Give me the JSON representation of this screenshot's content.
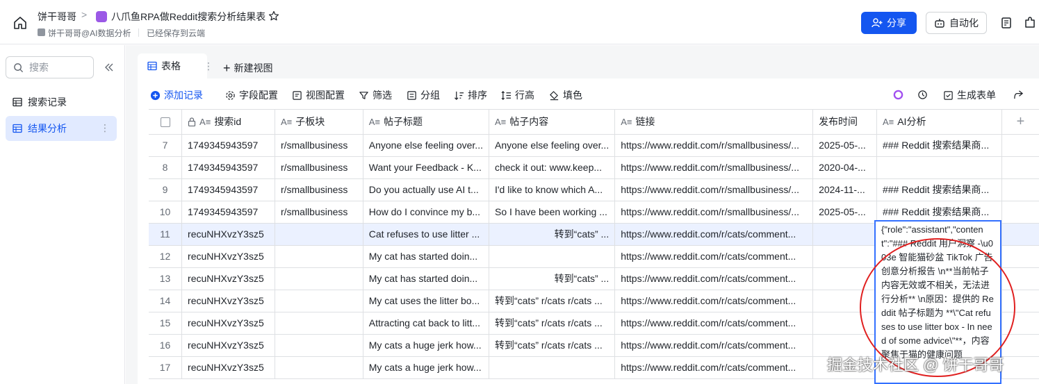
{
  "header": {
    "breadcrumb_root": "饼干哥哥",
    "breadcrumb_sep": ">",
    "doc_title": "八爪鱼RPA做Reddit搜索分析结果表",
    "owner": "饼干哥哥@AI数据分析",
    "save_status": "已经保存到云端",
    "share_label": "分享",
    "automation_label": "自动化",
    "accent_color": "#1456f0"
  },
  "sidebar": {
    "search_placeholder": "搜索",
    "items": [
      {
        "label": "搜索记录",
        "active": false
      },
      {
        "label": "结果分析",
        "active": true
      }
    ],
    "more_glyph": "⋮"
  },
  "tabs": {
    "active_label": "表格",
    "more_glyph": "⋮",
    "new_view_label": "新建视图"
  },
  "toolbar": {
    "add_record": "添加记录",
    "field_config": "字段配置",
    "view_config": "视图配置",
    "filter": "筛选",
    "group": "分组",
    "sort": "排序",
    "row_height": "行高",
    "fill": "填色",
    "generate_form": "生成表单"
  },
  "table": {
    "columns": [
      {
        "label": "搜索id",
        "glyph": "A≡",
        "locked": true
      },
      {
        "label": "子板块",
        "glyph": "A≡"
      },
      {
        "label": "帖子标题",
        "glyph": "A≡"
      },
      {
        "label": "帖子内容",
        "glyph": "A≡"
      },
      {
        "label": "链接",
        "glyph": "A≡"
      },
      {
        "label": "发布时间",
        "glyph": ""
      },
      {
        "label": "AI分析",
        "glyph": "A≡"
      }
    ],
    "add_column_glyph": "+",
    "rows": [
      {
        "num": "7",
        "id": "1749345943597",
        "sub": "r/smallbusiness",
        "title": "Anyone else feeling over...",
        "content": "Anyone else feeling over...",
        "link": "https://www.reddit.com/r/smallbusiness/...",
        "time": "2025-05-...",
        "ai": "### Reddit 搜索结果商..."
      },
      {
        "num": "8",
        "id": "1749345943597",
        "sub": "r/smallbusiness",
        "title": "Want your Feedback - K...",
        "content": "check it out: www.keep...",
        "link": "https://www.reddit.com/r/smallbusiness/...",
        "time": "2020-04-...",
        "ai": ""
      },
      {
        "num": "9",
        "id": "1749345943597",
        "sub": "r/smallbusiness",
        "title": "Do you actually use AI t...",
        "content": "I'd like to know which A...",
        "link": "https://www.reddit.com/r/smallbusiness/...",
        "time": "2024-11-...",
        "ai": "### Reddit 搜索结果商..."
      },
      {
        "num": "10",
        "id": "1749345943597",
        "sub": "r/smallbusiness",
        "title": "How do I convince my b...",
        "content": "So I have been working ...",
        "link": "https://www.reddit.com/r/smallbusiness/...",
        "time": "2025-05-...",
        "ai": "### Reddit 搜索结果商..."
      },
      {
        "num": "11",
        "id": "recuNHXvzY3sz5",
        "sub": "",
        "title": "Cat refuses to use litter ...",
        "content": "转到“cats” ...",
        "content_right": true,
        "link": "https://www.reddit.com/r/cats/comment...",
        "time": "",
        "ai": "",
        "selected": true
      },
      {
        "num": "12",
        "id": "recuNHXvzY3sz5",
        "sub": "",
        "title": "My cat has started doin...",
        "content": "",
        "link": "https://www.reddit.com/r/cats/comment...",
        "time": "",
        "ai": ""
      },
      {
        "num": "13",
        "id": "recuNHXvzY3sz5",
        "sub": "",
        "title": "My cat has started doin...",
        "content": "转到“cats” ...",
        "content_right": true,
        "link": "https://www.reddit.com/r/cats/comment...",
        "time": "",
        "ai": ""
      },
      {
        "num": "14",
        "id": "recuNHXvzY3sz5",
        "sub": "",
        "title": "My cat uses the litter bo...",
        "content": "转到“cats” r/cats r/cats ...",
        "link": "https://www.reddit.com/r/cats/comment...",
        "time": "",
        "ai": ""
      },
      {
        "num": "15",
        "id": "recuNHXvzY3sz5",
        "sub": "",
        "title": "Attracting cat back to litt...",
        "content": "转到“cats” r/cats r/cats ...",
        "link": "https://www.reddit.com/r/cats/comment...",
        "time": "",
        "ai": ""
      },
      {
        "num": "16",
        "id": "recuNHXvzY3sz5",
        "sub": "",
        "title": "My cats a huge jerk how...",
        "content": "转到“cats” r/cats r/cats ...",
        "link": "https://www.reddit.com/r/cats/comment...",
        "time": "",
        "ai": ""
      },
      {
        "num": "17",
        "id": "recuNHXvzY3sz5",
        "sub": "",
        "title": "My cats a huge jerk how...",
        "content": "",
        "link": "https://www.reddit.com/r/cats/comment...",
        "time": "",
        "ai": ""
      }
    ]
  },
  "expanded_cell": {
    "text": "{\"role\":\"assistant\",\"content\":\"### Reddit 用户洞察 -\\u003e 智能猫砂盆 TikTok 广告创意分析报告  \\n**当前帖子内容无效或不相关，无法进行分析**  \\n原因：提供的 Reddit 帖子标题为 **\\\"Cat refuses to use litter box - In need of some advice\\\"**，内容聚焦于猫的健康问题"
  },
  "watermark": "掘金技术社区 @ 饼干哥哥",
  "annotation_color": "#e02020"
}
